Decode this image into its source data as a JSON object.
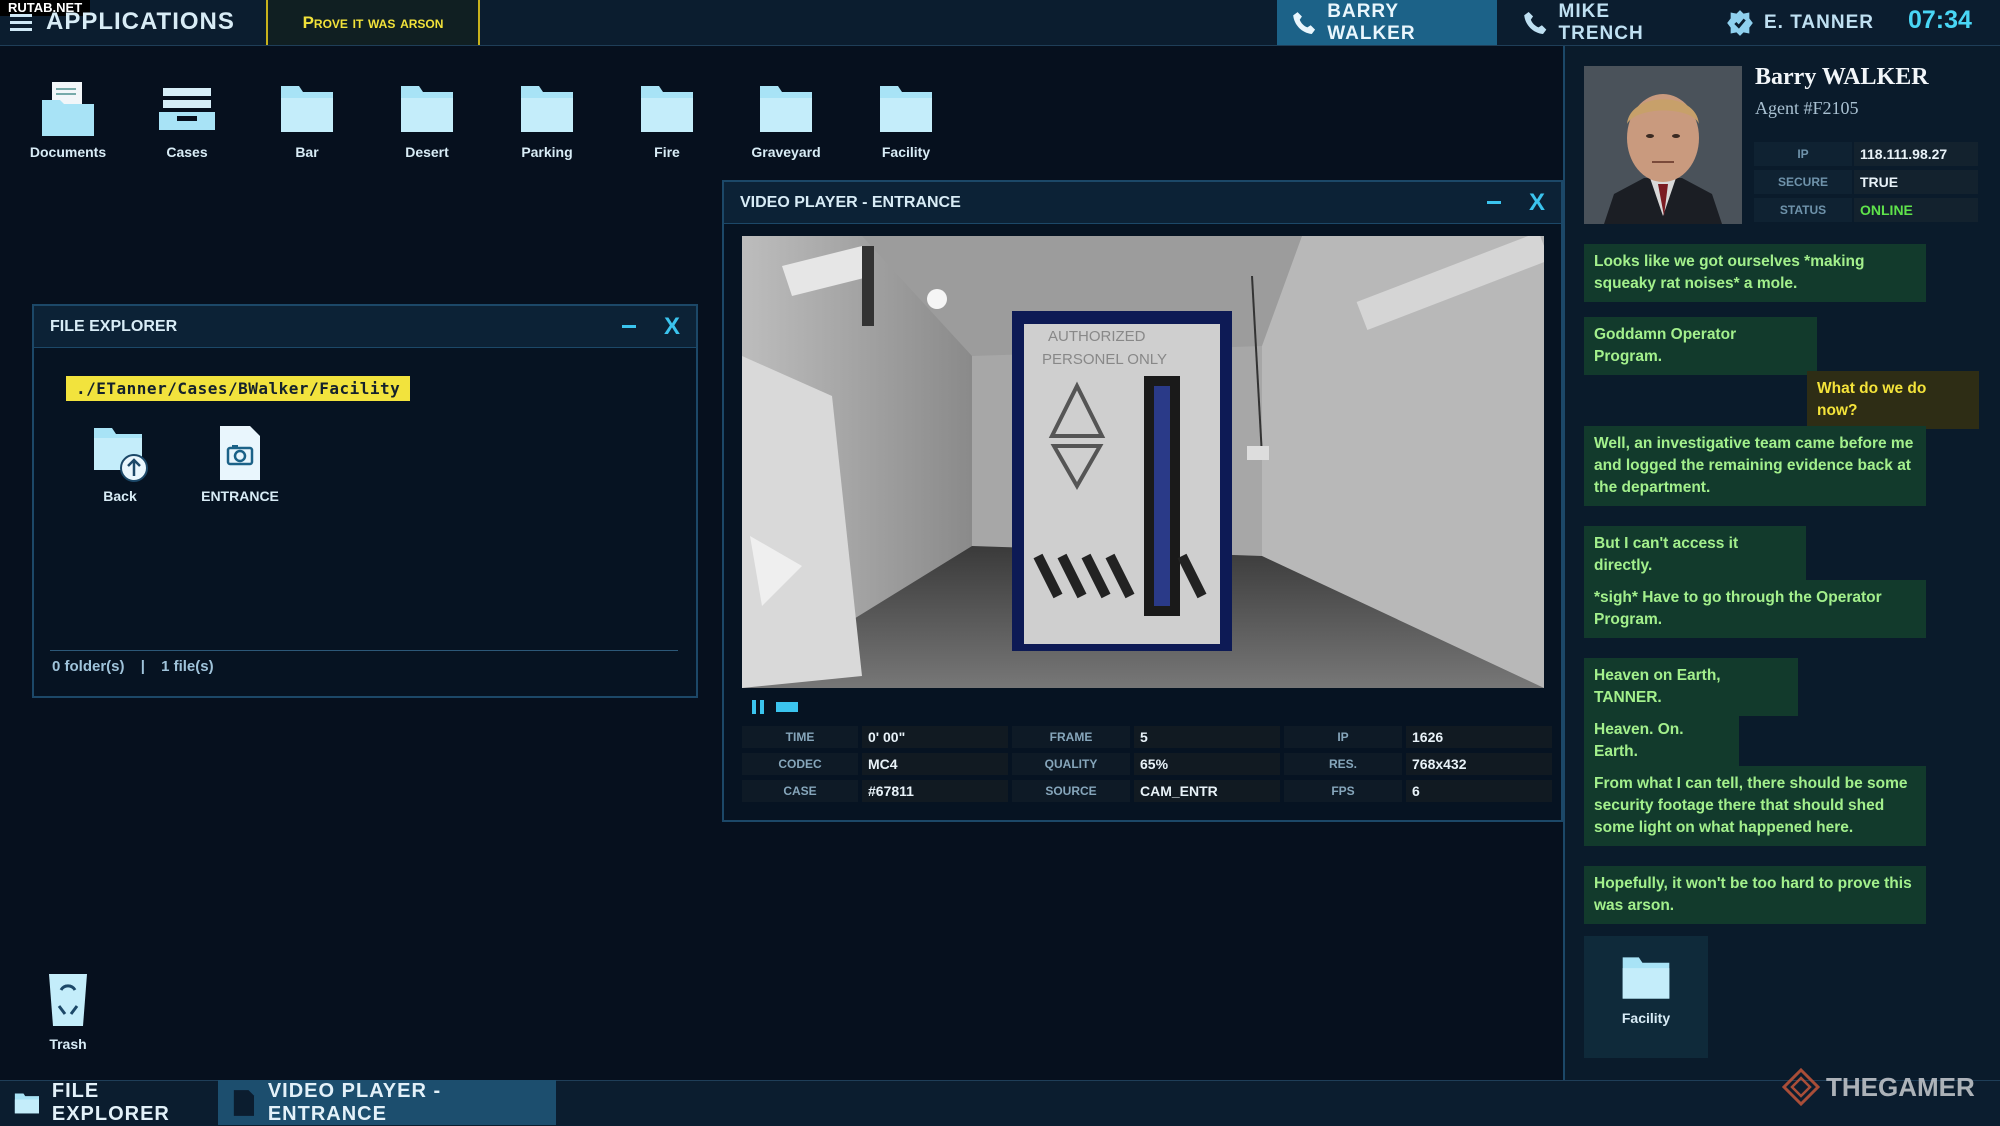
{
  "watermark_top": "RUTAB.NET",
  "topbar": {
    "menu_icon": "hamburger-icon",
    "title": "APPLICATIONS",
    "objective": "Prove it was arson",
    "contacts": [
      {
        "name": "BARRY WALKER",
        "icon": "phone-icon",
        "active": true
      },
      {
        "name": "MIKE TRENCH",
        "icon": "phone-icon",
        "active": false
      },
      {
        "name": "E. TANNER",
        "icon": "badge-icon",
        "active": false
      }
    ],
    "clock": "07:34"
  },
  "desktop": {
    "icons": [
      {
        "label": "Documents",
        "icon": "documents-folder-icon"
      },
      {
        "label": "Cases",
        "icon": "cases-tray-icon"
      },
      {
        "label": "Bar",
        "icon": "folder-icon"
      },
      {
        "label": "Desert",
        "icon": "folder-icon"
      },
      {
        "label": "Parking",
        "icon": "folder-icon"
      },
      {
        "label": "Fire",
        "icon": "folder-icon"
      },
      {
        "label": "Graveyard",
        "icon": "folder-icon"
      },
      {
        "label": "Facility",
        "icon": "folder-icon"
      }
    ],
    "trash_label": "Trash"
  },
  "file_explorer": {
    "title": "FILE EXPLORER",
    "path": "./ETanner/Cases/BWalker/Facility",
    "items": [
      {
        "label": "Back",
        "icon": "folder-up-icon"
      },
      {
        "label": "ENTRANCE",
        "icon": "camera-file-icon"
      }
    ],
    "folders_count": "0 folder(s)",
    "separator": "|",
    "files_count": "1 file(s)"
  },
  "video_player": {
    "title": "VIDEO PLAYER - ENTRANCE",
    "sign_line1": "AUTHORIZED",
    "sign_line2": "PERSONEL ONLY",
    "stats": [
      [
        {
          "label": "TIME",
          "value": "0' 00\""
        },
        {
          "label": "FRAME",
          "value": "5"
        },
        {
          "label": "IP",
          "value": "1626"
        }
      ],
      [
        {
          "label": "CODEC",
          "value": "MC4"
        },
        {
          "label": "QUALITY",
          "value": "65%"
        },
        {
          "label": "RES.",
          "value": "768x432"
        }
      ],
      [
        {
          "label": "CASE",
          "value": "#67811"
        },
        {
          "label": "SOURCE",
          "value": "CAM_ENTR"
        },
        {
          "label": "FPS",
          "value": "6"
        }
      ]
    ]
  },
  "agent": {
    "name": "Barry WALKER",
    "id": "Agent #F2105",
    "info": [
      {
        "label": "IP",
        "value": "118.111.98.27"
      },
      {
        "label": "SECURE",
        "value": "TRUE"
      },
      {
        "label": "STATUS",
        "value": "ONLINE"
      }
    ],
    "status_color": "#5fe24b",
    "attachment_label": "Facility"
  },
  "chat": [
    {
      "from": "agent",
      "text": "Looks like we got ourselves *making squeaky rat noises* a mole."
    },
    {
      "from": "agent",
      "text": "Goddamn Operator Program."
    },
    {
      "from": "me",
      "text": "What do we do now?"
    },
    {
      "from": "agent",
      "text": "Well, an investigative team came before me and logged the remaining evidence back at the department."
    },
    {
      "from": "agent",
      "text": "But I can't access it directly."
    },
    {
      "from": "agent",
      "text": "*sigh* Have to go through the Operator Program."
    },
    {
      "from": "agent",
      "text": "Heaven on Earth, TANNER."
    },
    {
      "from": "agent",
      "text": "Heaven. On. Earth."
    },
    {
      "from": "agent",
      "text": "From what I can tell, there should be some security footage there that should shed some light on what happened here."
    },
    {
      "from": "agent",
      "text": "Hopefully, it won't be too hard to prove this was arson."
    }
  ],
  "taskbar": {
    "items": [
      {
        "label": "FILE EXPLORER",
        "icon": "folder-icon"
      },
      {
        "label": "VIDEO PLAYER - ENTRANCE",
        "icon": "video-file-icon"
      }
    ]
  },
  "brand_watermark": "THEGAMER"
}
